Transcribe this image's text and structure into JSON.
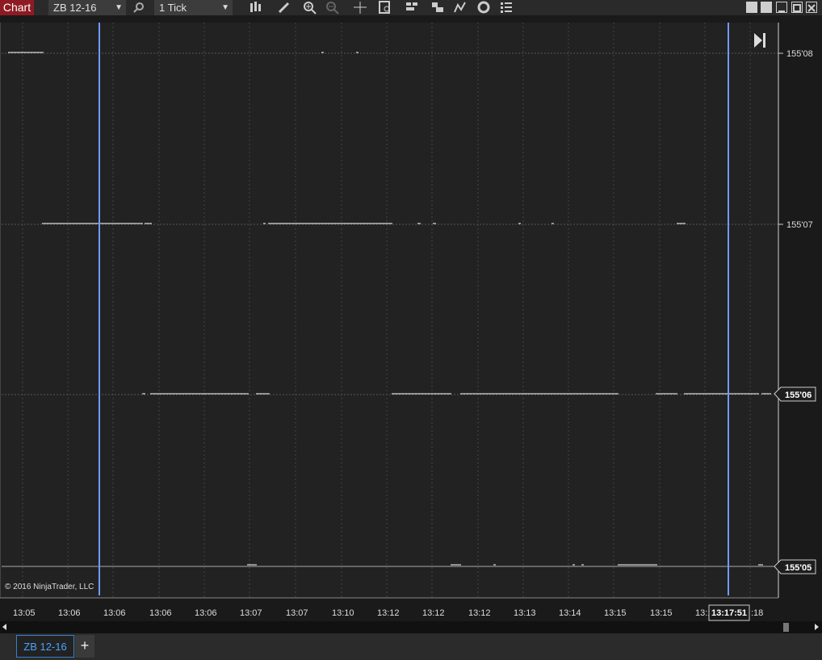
{
  "toolbar": {
    "chart_label": "Chart",
    "instrument": "ZB 12-16",
    "interval": "1 Tick",
    "icons": [
      "search-icon",
      "bars-icon",
      "pencil-icon",
      "zoom-in-icon",
      "zoom-out-icon",
      "crosshair-icon",
      "data-box-icon",
      "bar-style-icon",
      "price-marker-icon",
      "strategy-icon",
      "refresh-icon",
      "properties-icon"
    ],
    "window_icons": [
      "tile-icon",
      "tile-icon",
      "minimize-icon",
      "maximize-icon",
      "close-icon"
    ]
  },
  "chart": {
    "copyright": "© 2016 NinjaTrader, LLC",
    "price_labels": [
      "155'08",
      "155'07",
      "155'06",
      "155'05"
    ],
    "highlighted_prices": [
      "155'06",
      "155'05"
    ],
    "time_labels": [
      "13:05",
      "13:06",
      "13:06",
      "13:06",
      "13:06",
      "13:07",
      "13:07",
      "13:10",
      "13:12",
      "13:12",
      "13:12",
      "13:13",
      "13:14",
      "13:15",
      "13:15",
      "13:1",
      "13:17:51",
      ":18"
    ],
    "crosshair_time": "13:17:51",
    "colors": {
      "background": "#222222",
      "price_line": "#ffffff",
      "vertical_marker": "#6f9cff",
      "accent": "#8e1b23"
    }
  },
  "tabs": {
    "active": "ZB 12-16",
    "add_label": "+"
  }
}
